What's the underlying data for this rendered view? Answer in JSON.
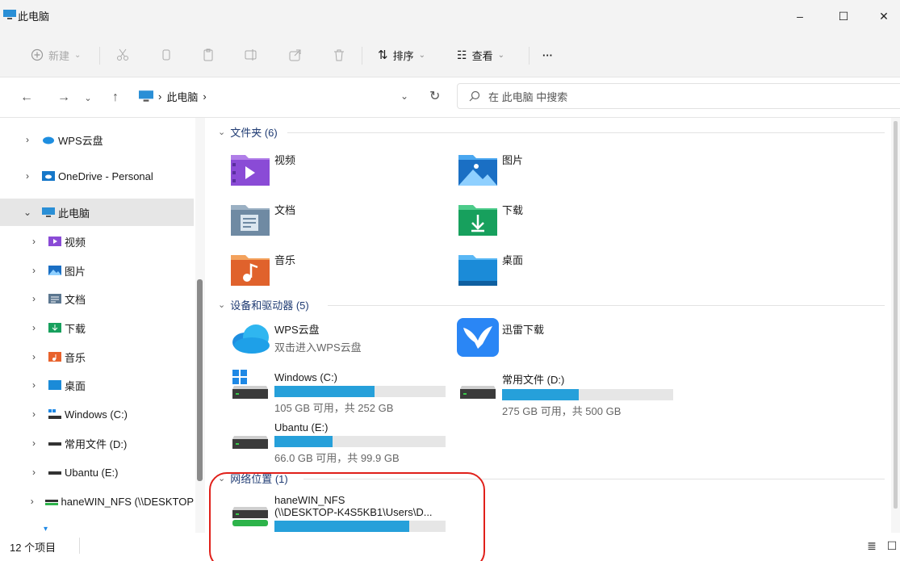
{
  "window": {
    "title": "此电脑",
    "minimize_label": "–",
    "maximize_label": "☐",
    "close_label": "✕"
  },
  "commandbar": {
    "new_label": "新建",
    "sort_label": "排序",
    "view_label": "查看",
    "more_label": "···"
  },
  "addressbar": {
    "location": "此电脑",
    "search_placeholder": "在 此电脑 中搜索"
  },
  "sidebar": {
    "items": [
      {
        "label": "WPS云盘"
      },
      {
        "label": "OneDrive - Personal"
      },
      {
        "label": "此电脑"
      },
      {
        "label": "视频"
      },
      {
        "label": "图片"
      },
      {
        "label": "文档"
      },
      {
        "label": "下载"
      },
      {
        "label": "音乐"
      },
      {
        "label": "桌面"
      },
      {
        "label": "Windows (C:)"
      },
      {
        "label": "常用文件 (D:)"
      },
      {
        "label": "Ubantu (E:)"
      },
      {
        "label": "haneWIN_NFS (\\\\DESKTOP"
      }
    ]
  },
  "sections": {
    "folders": {
      "header": "文件夹 (6)",
      "items": [
        {
          "label": "视频"
        },
        {
          "label": "图片"
        },
        {
          "label": "文档"
        },
        {
          "label": "下载"
        },
        {
          "label": "音乐"
        },
        {
          "label": "桌面"
        }
      ]
    },
    "devices": {
      "header": "设备和驱动器 (5)",
      "wps": {
        "label": "WPS云盘",
        "sub": "双击进入WPS云盘"
      },
      "xunlei": {
        "label": "迅雷下载"
      },
      "drives": [
        {
          "label": "Windows (C:)",
          "space": "105 GB 可用，共 252 GB",
          "used_fraction": 0.583
        },
        {
          "label": "常用文件 (D:)",
          "space": "275 GB 可用，共 500 GB",
          "used_fraction": 0.45
        },
        {
          "label": "Ubantu (E:)",
          "space": "66.0 GB 可用，共 99.9 GB",
          "used_fraction": 0.339
        }
      ]
    },
    "network": {
      "header": "网络位置 (1)",
      "item": {
        "label": "haneWIN_NFS",
        "path": "(\\\\DESKTOP-K4S5KB1\\Users\\D...",
        "used_fraction": 0.79
      }
    }
  },
  "status": {
    "count": "12 个项目"
  },
  "colors": {
    "bar_fill": "#26a0da",
    "bar_track": "#e6e6e6",
    "selection": "#e6e6e6",
    "annotation": "#e0201a"
  }
}
